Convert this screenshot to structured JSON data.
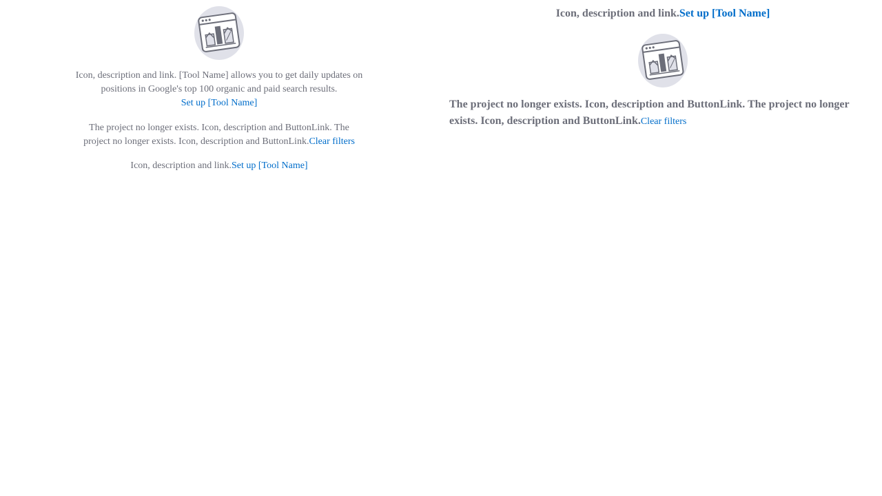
{
  "left": {
    "block1": {
      "description": "Icon, description and link. [Tool Name] allows you to get daily updates on positions in Google's top 100 organic and paid search results.",
      "link": "Set up [Tool Name]"
    },
    "block2": {
      "description": "The project no longer exists. Icon, description and ButtonLink. The project no longer exists. Icon, description and ButtonLink.",
      "link": "Clear filters"
    },
    "block3": {
      "description": "Icon, description and link.",
      "link": "Set up [Tool Name]"
    }
  },
  "right": {
    "title": {
      "description": "Icon, description and link.",
      "link": "Set up [Tool Name]"
    },
    "block": {
      "description": "The project no longer exists. Icon, description and ButtonLink. The project no longer exists. Icon, description and ButtonLink.",
      "link": "Clear filters"
    }
  },
  "illustration": {
    "name": "empty-state-dashboard-icon",
    "colors": {
      "circle": "#e0e1e9",
      "stroke": "#6c6e79",
      "window": "#ffffff"
    }
  }
}
